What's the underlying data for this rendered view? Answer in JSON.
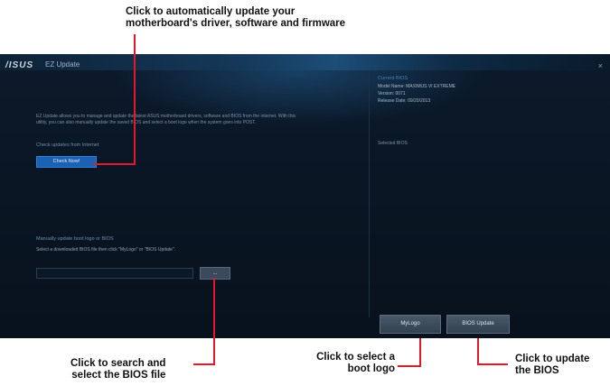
{
  "callouts": {
    "top_line1": "Click to automatically update your",
    "top_line2": "motherboard's driver, software and firmware",
    "search_line1": "Click to search and",
    "search_line2": "select the BIOS file",
    "logo_line1": "Click to select a",
    "logo_line2": "boot logo",
    "update_line1": "Click to update",
    "update_line2": "the BIOS"
  },
  "window": {
    "brand": "/ISUS",
    "title": "EZ Update",
    "close": "×"
  },
  "main": {
    "description": "EZ Update allows you to manage and update the latest ASUS motherboard drivers, software and BIOS from the internet. With this utility, you can also manually update the saved BIOS and select a boot logo when the system goes into POST.",
    "check_label": "Check updates from Internet",
    "check_button": "Check Now!",
    "manual_label": "Manually update boot logo or BIOS",
    "manual_sub": "Select a downloaded BIOS file then click \"MyLogo\" or \"BIOS Update\".",
    "path_value": "",
    "browse_button": "..."
  },
  "info": {
    "title": "Current BIOS",
    "model": "Model Name: MAXIMUS VI EXTREME",
    "version": "Version: 0071",
    "release": "Release Date: 09/20/2013",
    "selected": "Selected BIOS"
  },
  "buttons": {
    "mylogo": "MyLogo",
    "bios_update": "BIOS Update"
  },
  "colors": {
    "accent": "#e3192b",
    "button_blue": "#1b62b5"
  }
}
